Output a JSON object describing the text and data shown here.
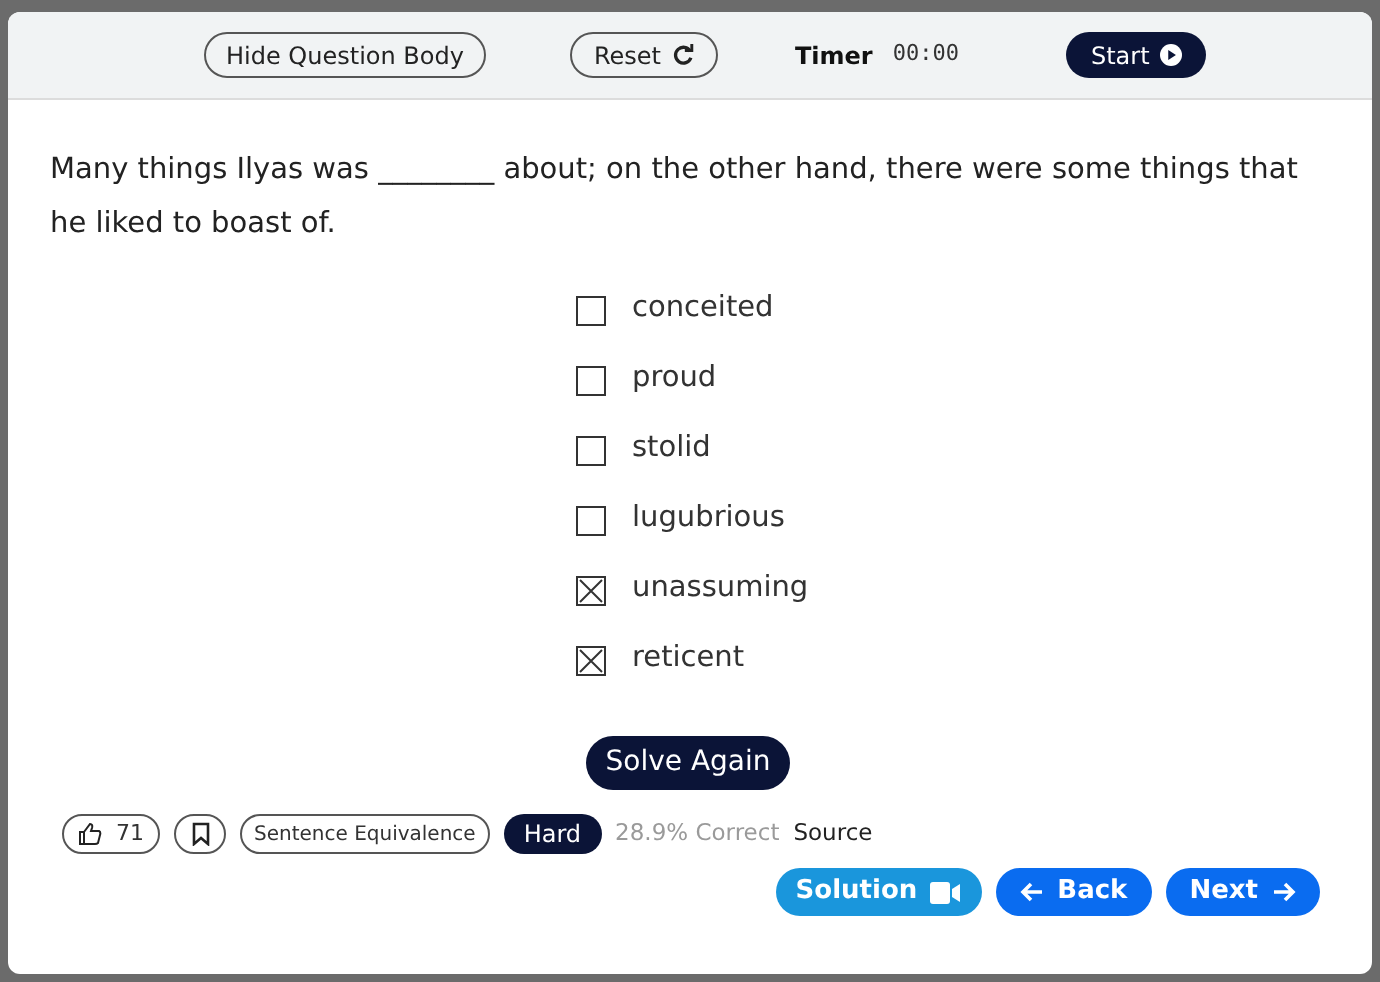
{
  "toolbar": {
    "hide_button": "Hide Question Body",
    "reset_button": "Reset",
    "timer_label": "Timer",
    "timer_value": "00:00",
    "start_button": "Start"
  },
  "question": "Many things Ilyas was ________ about; on the other hand, there were some things that he liked to boast of.",
  "options": [
    {
      "label": "conceited",
      "checked": false
    },
    {
      "label": "proud",
      "checked": false
    },
    {
      "label": "stolid",
      "checked": false
    },
    {
      "label": "lugubrious",
      "checked": false
    },
    {
      "label": "unassuming",
      "checked": true
    },
    {
      "label": "reticent",
      "checked": true
    }
  ],
  "solve_again_button": "Solve Again",
  "meta": {
    "likes": "71",
    "category": "Sentence Equivalence",
    "difficulty": "Hard",
    "correct_rate": "28.9% Correct",
    "source": "Source"
  },
  "nav": {
    "solution": "Solution",
    "back": "Back",
    "next": "Next"
  }
}
